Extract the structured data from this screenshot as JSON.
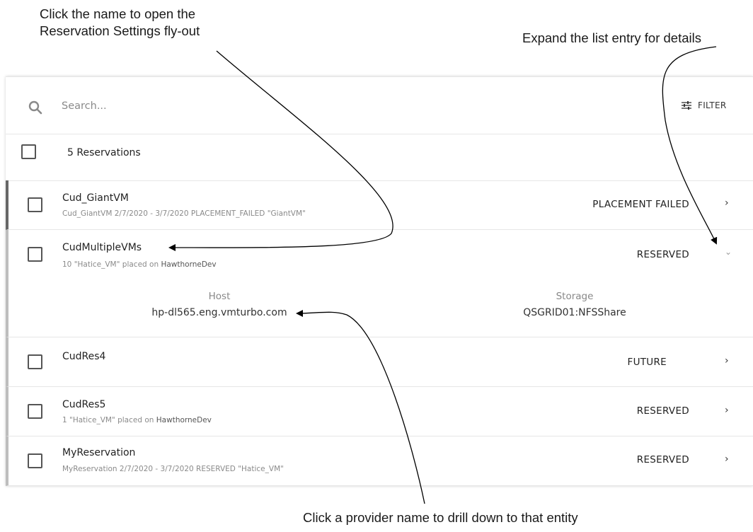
{
  "callouts": {
    "top_left_line1": "Click the name to open the",
    "top_left_line2": "Reservation Settings fly-out",
    "top_right": "Expand the list entry for details",
    "bottom": "Click a provider name to drill down to that entity"
  },
  "search": {
    "placeholder": "Search...",
    "icon": "search-icon"
  },
  "filter": {
    "label": "FILTER",
    "icon": "sliders-icon"
  },
  "summary": {
    "count_label": "5 Reservations"
  },
  "reservations": [
    {
      "name": "Cud_GiantVM",
      "subtitle": "Cud_GiantVM 2/7/2020 - 3/7/2020 PLACEMENT_FAILED \"GiantVM\"",
      "status": "PLACEMENT FAILED",
      "expanded": false
    },
    {
      "name": "CudMultipleVMs",
      "subtitle_prefix": "10 \"Hatice_VM\" placed on ",
      "subtitle_link": "HawthorneDev",
      "status": "RESERVED",
      "expanded": true,
      "details": {
        "host_label": "Host",
        "host_value": "hp-dl565.eng.vmturbo.com",
        "storage_label": "Storage",
        "storage_value": "QSGRID01:NFSShare"
      }
    },
    {
      "name": "CudRes4",
      "subtitle": "",
      "status": "FUTURE",
      "expanded": false
    },
    {
      "name": "CudRes5",
      "subtitle_prefix": "1 \"Hatice_VM\" placed on ",
      "subtitle_link": "HawthorneDev",
      "status": "RESERVED",
      "expanded": false
    },
    {
      "name": "MyReservation",
      "subtitle": "MyReservation 2/7/2020 - 3/7/2020 RESERVED \"Hatice_VM\"",
      "status": "RESERVED",
      "expanded": false
    }
  ],
  "icons": {
    "collapsed": "›",
    "expanded": "⌄"
  },
  "colors": {
    "failed_bar": "#666666",
    "normal_bar": "#bdbdbd"
  }
}
